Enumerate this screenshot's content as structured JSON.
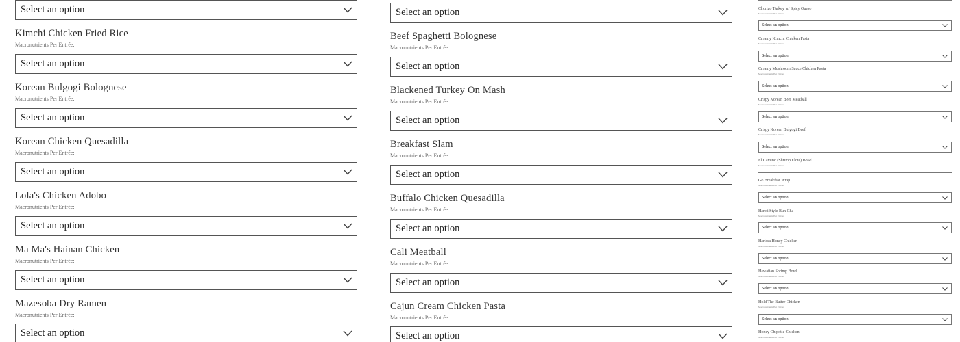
{
  "select_placeholder": "Select an option",
  "subtitle_text": "Macronutrients Per Entrée:",
  "column_left": {
    "items": [
      {
        "title": "Kimchi Chicken Fried Rice"
      },
      {
        "title": "Korean Bulgogi Bolognese"
      },
      {
        "title": "Korean Chicken Quesadilla"
      },
      {
        "title": "Lola's Chicken Adobo"
      },
      {
        "title": "Ma Ma's Hainan Chicken"
      },
      {
        "title": "Mazesoba Dry Ramen"
      }
    ]
  },
  "column_middle": {
    "items": [
      {
        "title": "Beef Spaghetti Bolognese"
      },
      {
        "title": "Blackened Turkey On Mash"
      },
      {
        "title": "Breakfast Slam"
      },
      {
        "title": "Buffalo Chicken Quesadilla"
      },
      {
        "title": "Cali Meatball"
      },
      {
        "title": "Cajun Cream Chicken Pasta"
      }
    ]
  },
  "column_right": {
    "items": [
      {
        "title": "Chorizo Turkey w/ Spicy Queso"
      },
      {
        "title": "Creamy Kimchi Chicken Pasta"
      },
      {
        "title": "Creamy Mushroom Sauce Chicken Pasta"
      },
      {
        "title": "Crispy Korean Beef Meatball"
      },
      {
        "title": "Crispy Korean Bulgogi Beef"
      },
      {
        "title": "El Camino (Shrimp Elote) Bowl"
      },
      {
        "title": "Go Breakfast Wrap"
      },
      {
        "title": "Hanoi Style Bun Cha"
      },
      {
        "title": "Harissa Honey Chicken"
      },
      {
        "title": "Hawaiian Shrimp Bowl"
      },
      {
        "title": "Hold The Butter Chicken"
      },
      {
        "title": "Honey Chipotle Chicken"
      }
    ]
  }
}
